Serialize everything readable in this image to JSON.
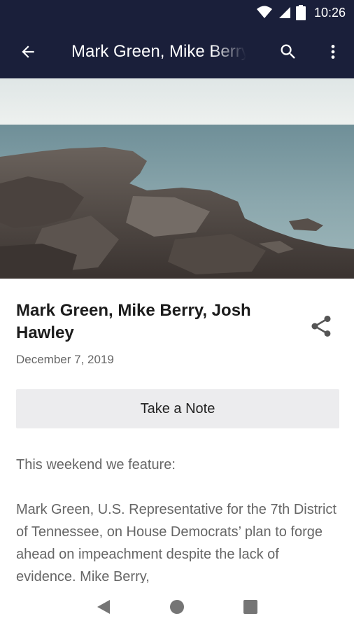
{
  "status_bar": {
    "time": "10:26",
    "icons": [
      "wifi-icon",
      "cell-signal-icon",
      "battery-icon"
    ]
  },
  "app_bar": {
    "title": "Mark Green, Mike Berry, Josh Hawley",
    "icons": [
      "back-arrow-icon",
      "search-icon",
      "more-vert-icon"
    ]
  },
  "episode": {
    "title": "Mark Green, Mike Berry, Josh Hawley",
    "date": "December 7, 2019",
    "share_icon": "share-icon",
    "note_button_label": "Take a Note",
    "paragraphs": [
      "This weekend we feature:",
      "Mark Green, U.S. Representative for the 7th District of Tennessee, on House Democrats’ plan to forge ahead on impeachment despite the lack of evidence. Mike Berry,"
    ]
  },
  "nav_bar": {
    "icons": [
      "nav-back-icon",
      "nav-home-icon",
      "nav-recents-icon"
    ]
  },
  "colors": {
    "app_bar": "#1a1f3a",
    "button_bg": "#ececee",
    "title_text": "#1c1c1c",
    "secondary_text": "#666666"
  }
}
